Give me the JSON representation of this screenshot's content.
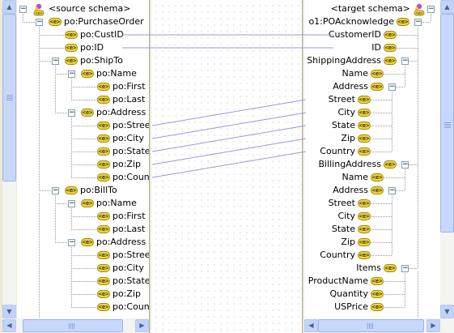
{
  "source": {
    "root_label": "<source schema>",
    "rows": [
      {
        "label": "po:PurchaseOrder",
        "level": 1,
        "toggle": "-"
      },
      {
        "label": "po:CustID",
        "level": 2,
        "toggle": null
      },
      {
        "label": "po:ID",
        "level": 2,
        "toggle": null
      },
      {
        "label": "po:ShipTo",
        "level": 2,
        "toggle": "-"
      },
      {
        "label": "po:Name",
        "level": 3,
        "toggle": "-"
      },
      {
        "label": "po:First",
        "level": 4,
        "toggle": null
      },
      {
        "label": "po:Last",
        "level": 4,
        "toggle": null
      },
      {
        "label": "po:Address",
        "level": 3,
        "toggle": "-"
      },
      {
        "label": "po:Street",
        "level": 4,
        "toggle": null
      },
      {
        "label": "po:City",
        "level": 4,
        "toggle": null
      },
      {
        "label": "po:State",
        "level": 4,
        "toggle": null
      },
      {
        "label": "po:Zip",
        "level": 4,
        "toggle": null
      },
      {
        "label": "po:Country",
        "level": 4,
        "toggle": null
      },
      {
        "label": "po:BillTo",
        "level": 2,
        "toggle": "-"
      },
      {
        "label": "po:Name",
        "level": 3,
        "toggle": "-"
      },
      {
        "label": "po:First",
        "level": 4,
        "toggle": null
      },
      {
        "label": "po:Last",
        "level": 4,
        "toggle": null
      },
      {
        "label": "po:Address",
        "level": 3,
        "toggle": "-"
      },
      {
        "label": "po:Street",
        "level": 4,
        "toggle": null
      },
      {
        "label": "po:City",
        "level": 4,
        "toggle": null
      },
      {
        "label": "po:State",
        "level": 4,
        "toggle": null
      },
      {
        "label": "po:Zip",
        "level": 4,
        "toggle": null
      },
      {
        "label": "po:Country",
        "level": 4,
        "toggle": null
      }
    ]
  },
  "target": {
    "root_label": "<target schema>",
    "rows": [
      {
        "label": "o1:POAcknowledge",
        "level": 1,
        "toggle": "-"
      },
      {
        "label": "CustomerID",
        "level": 2,
        "toggle": null
      },
      {
        "label": "ID",
        "level": 2,
        "toggle": null
      },
      {
        "label": "ShippingAddress",
        "level": 2,
        "toggle": "-"
      },
      {
        "label": "Name",
        "level": 3,
        "toggle": null
      },
      {
        "label": "Address",
        "level": 3,
        "toggle": "-"
      },
      {
        "label": "Street",
        "level": 4,
        "toggle": null
      },
      {
        "label": "City",
        "level": 4,
        "toggle": null
      },
      {
        "label": "State",
        "level": 4,
        "toggle": null
      },
      {
        "label": "Zip",
        "level": 4,
        "toggle": null
      },
      {
        "label": "Country",
        "level": 4,
        "toggle": null
      },
      {
        "label": "BillingAddress",
        "level": 2,
        "toggle": "-"
      },
      {
        "label": "Name",
        "level": 3,
        "toggle": null
      },
      {
        "label": "Address",
        "level": 3,
        "toggle": "-"
      },
      {
        "label": "Street",
        "level": 4,
        "toggle": null
      },
      {
        "label": "City",
        "level": 4,
        "toggle": null
      },
      {
        "label": "State",
        "level": 4,
        "toggle": null
      },
      {
        "label": "Zip",
        "level": 4,
        "toggle": null
      },
      {
        "label": "Country",
        "level": 4,
        "toggle": null
      },
      {
        "label": "Items",
        "level": 2,
        "toggle": "-"
      },
      {
        "label": "ProductName",
        "level": 3,
        "toggle": null
      },
      {
        "label": "Quantity",
        "level": 3,
        "toggle": null
      },
      {
        "label": "USPrice",
        "level": 3,
        "toggle": null
      }
    ]
  },
  "mappings": [
    {
      "source": "po:CustID",
      "target": "CustomerID"
    },
    {
      "source": "po:ID",
      "target": "ID"
    },
    {
      "source": "po:ShipTo/po:Address/po:Street",
      "target": "ShippingAddress/Address/Street"
    },
    {
      "source": "po:ShipTo/po:Address/po:City",
      "target": "ShippingAddress/Address/City"
    },
    {
      "source": "po:ShipTo/po:Address/po:State",
      "target": "ShippingAddress/Address/State"
    },
    {
      "source": "po:ShipTo/po:Address/po:Zip",
      "target": "ShippingAddress/Address/Zip"
    },
    {
      "source": "po:ShipTo/po:Address/po:Country",
      "target": "ShippingAddress/Address/Country"
    }
  ],
  "icons": {
    "element": "element-icon",
    "schema_root": "schema-root-icon",
    "expand_collapse": "minus-box-icon"
  },
  "colors": {
    "mapping_line": "#9a9ad6",
    "element_icon": "#f1d52f",
    "scrollbar": "#c1d3fb"
  }
}
